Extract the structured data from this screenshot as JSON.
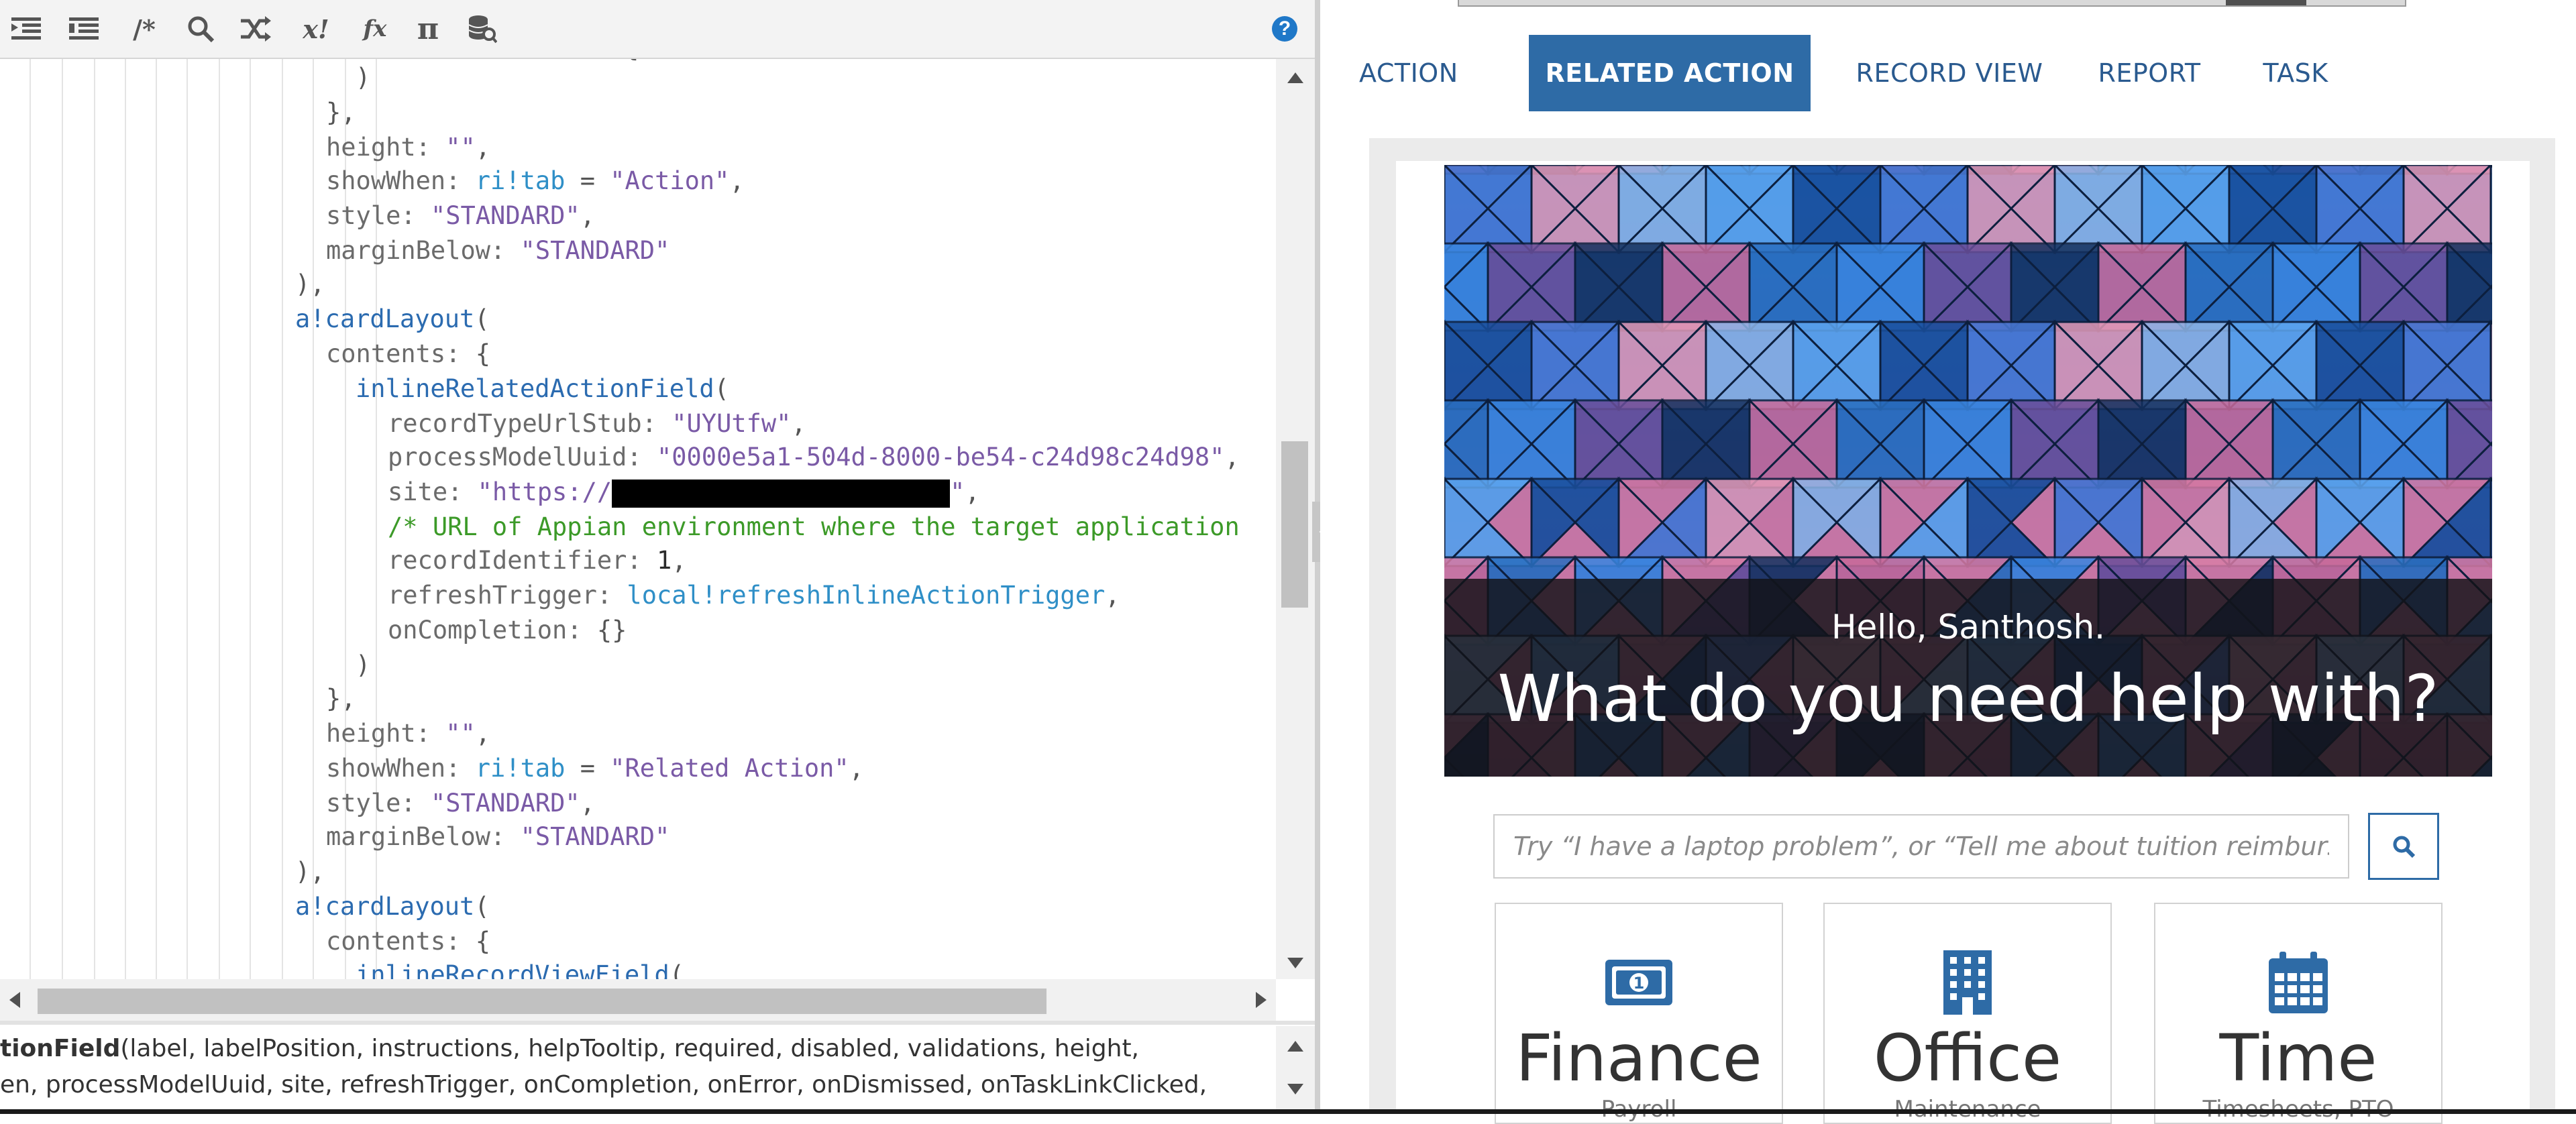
{
  "editor": {
    "toolbar": [
      {
        "name": "indent-icon"
      },
      {
        "name": "outdent-icon"
      },
      {
        "name": "comment-icon",
        "label": "/*"
      },
      {
        "name": "search-icon"
      },
      {
        "name": "shuffle-icon"
      },
      {
        "name": "variable-icon",
        "label": "x!"
      },
      {
        "name": "function-icon",
        "label": "fx"
      },
      {
        "name": "pi-icon",
        "label": "π"
      },
      {
        "name": "database-search-icon"
      }
    ],
    "help_label": "?",
    "lines": [
      [
        {
          "t": "plain",
          "s": "{"
        }
      ],
      [
        {
          "t": "plain",
          "s": ")"
        }
      ],
      [
        {
          "t": "plain",
          "s": "},"
        }
      ],
      [
        {
          "t": "key",
          "s": "height: "
        },
        {
          "t": "str",
          "s": "\"\""
        },
        {
          "t": "plain",
          "s": ","
        }
      ],
      [
        {
          "t": "key",
          "s": "showWhen: "
        },
        {
          "t": "local",
          "s": "ri!tab"
        },
        {
          "t": "plain",
          "s": " = "
        },
        {
          "t": "str",
          "s": "\"Action\""
        },
        {
          "t": "plain",
          "s": ","
        }
      ],
      [
        {
          "t": "key",
          "s": "style: "
        },
        {
          "t": "str",
          "s": "\"STANDARD\""
        },
        {
          "t": "plain",
          "s": ","
        }
      ],
      [
        {
          "t": "key",
          "s": "marginBelow: "
        },
        {
          "t": "str",
          "s": "\"STANDARD\""
        }
      ],
      [
        {
          "t": "plain",
          "s": "),"
        }
      ],
      [
        {
          "t": "fn",
          "s": "a!cardLayout"
        },
        {
          "t": "plain",
          "s": "("
        }
      ],
      [
        {
          "t": "key",
          "s": "contents: "
        },
        {
          "t": "plain",
          "s": "{"
        }
      ],
      [
        {
          "t": "fn",
          "s": "inlineRelatedActionField"
        },
        {
          "t": "plain",
          "s": "("
        }
      ],
      [
        {
          "t": "key",
          "s": "recordTypeUrlStub: "
        },
        {
          "t": "str",
          "s": "\"UYUtfw\""
        },
        {
          "t": "plain",
          "s": ","
        }
      ],
      [
        {
          "t": "key",
          "s": "processModelUuid: "
        },
        {
          "t": "str",
          "s": "\"0000e5a1-504d-8000-be54-c24d98c24d98\""
        },
        {
          "t": "plain",
          "s": ","
        }
      ],
      [
        {
          "t": "key",
          "s": "site: "
        },
        {
          "t": "str",
          "s": "\"https://"
        },
        {
          "t": "redact",
          "s": ""
        },
        {
          "t": "str",
          "s": "\""
        },
        {
          "t": "plain",
          "s": ","
        }
      ],
      [
        {
          "t": "comment",
          "s": "/* URL of Appian environment where the target application"
        }
      ],
      [
        {
          "t": "key",
          "s": "recordIdentifier: "
        },
        {
          "t": "num",
          "s": "1"
        },
        {
          "t": "plain",
          "s": ","
        }
      ],
      [
        {
          "t": "key",
          "s": "refreshTrigger: "
        },
        {
          "t": "local",
          "s": "local!refreshInlineActionTrigger"
        },
        {
          "t": "plain",
          "s": ","
        }
      ],
      [
        {
          "t": "key",
          "s": "onCompletion: "
        },
        {
          "t": "plain",
          "s": "{}"
        }
      ],
      [
        {
          "t": "plain",
          "s": ")"
        }
      ],
      [
        {
          "t": "plain",
          "s": "},"
        }
      ],
      [
        {
          "t": "key",
          "s": "height: "
        },
        {
          "t": "str",
          "s": "\"\""
        },
        {
          "t": "plain",
          "s": ","
        }
      ],
      [
        {
          "t": "key",
          "s": "showWhen: "
        },
        {
          "t": "local",
          "s": "ri!tab"
        },
        {
          "t": "plain",
          "s": " = "
        },
        {
          "t": "str",
          "s": "\"Related Action\""
        },
        {
          "t": "plain",
          "s": ","
        }
      ],
      [
        {
          "t": "key",
          "s": "style: "
        },
        {
          "t": "str",
          "s": "\"STANDARD\""
        },
        {
          "t": "plain",
          "s": ","
        }
      ],
      [
        {
          "t": "key",
          "s": "marginBelow: "
        },
        {
          "t": "str",
          "s": "\"STANDARD\""
        }
      ],
      [
        {
          "t": "plain",
          "s": "),"
        }
      ],
      [
        {
          "t": "fn",
          "s": "a!cardLayout"
        },
        {
          "t": "plain",
          "s": "("
        }
      ],
      [
        {
          "t": "key",
          "s": "contents: "
        },
        {
          "t": "plain",
          "s": "{"
        }
      ],
      [
        {
          "t": "fn",
          "s": "inlineRecordViewField"
        },
        {
          "t": "plain",
          "s": "("
        }
      ]
    ],
    "signature_hint": {
      "line1_bold": "tionField",
      "line1_rest": "(label, labelPosition, instructions, helpTooltip, required, disabled, validations, height,",
      "line2": "en, processModelUuid, site, refreshTrigger, onCompletion, onError, onDismissed, onTaskLinkClicked,"
    }
  },
  "preview": {
    "tabs": [
      {
        "label": "ACTION",
        "active": false
      },
      {
        "label": "RELATED ACTION",
        "active": true
      },
      {
        "label": "RECORD VIEW",
        "active": false
      },
      {
        "label": "REPORT",
        "active": false
      },
      {
        "label": "TASK",
        "active": false
      }
    ],
    "greeting": "Hello, Santhosh.",
    "headline": "What do you need help with?",
    "search": {
      "placeholder": "Try “I have a laptop problem”, or “Tell me about tuition reimbursement”"
    },
    "tiles": [
      {
        "title": "Finance",
        "subtitle": "Payroll",
        "icon": "money-icon"
      },
      {
        "title": "Office",
        "subtitle": "Maintenance",
        "icon": "building-icon"
      },
      {
        "title": "Time",
        "subtitle": "Timesheets, PTO",
        "icon": "calendar-icon"
      }
    ],
    "colors": {
      "accent": "#2e6ba6",
      "tab_text": "#2a5a8f",
      "comment": "#3c9a28",
      "string": "#7a5aa6",
      "keyword_fn": "#2b6bb0"
    }
  }
}
